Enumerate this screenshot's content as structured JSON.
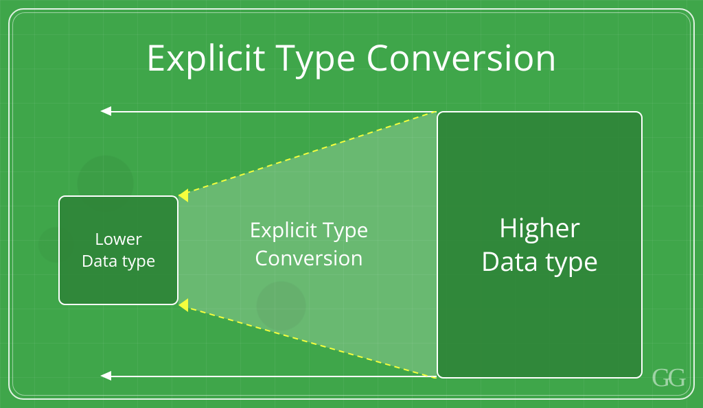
{
  "title": "Explicit Type Conversion",
  "boxes": {
    "lower": {
      "line1": "Lower",
      "line2": "Data type"
    },
    "higher": {
      "line1": "Higher",
      "line2": "Data type"
    }
  },
  "connector": {
    "label_line1": "Explicit Type",
    "label_line2": "Conversion"
  },
  "logo": "GG",
  "colors": {
    "background": "#3fa64a",
    "box_fill": "#2e8237",
    "dashed": "#f5ff3d",
    "text": "#ffffff"
  }
}
